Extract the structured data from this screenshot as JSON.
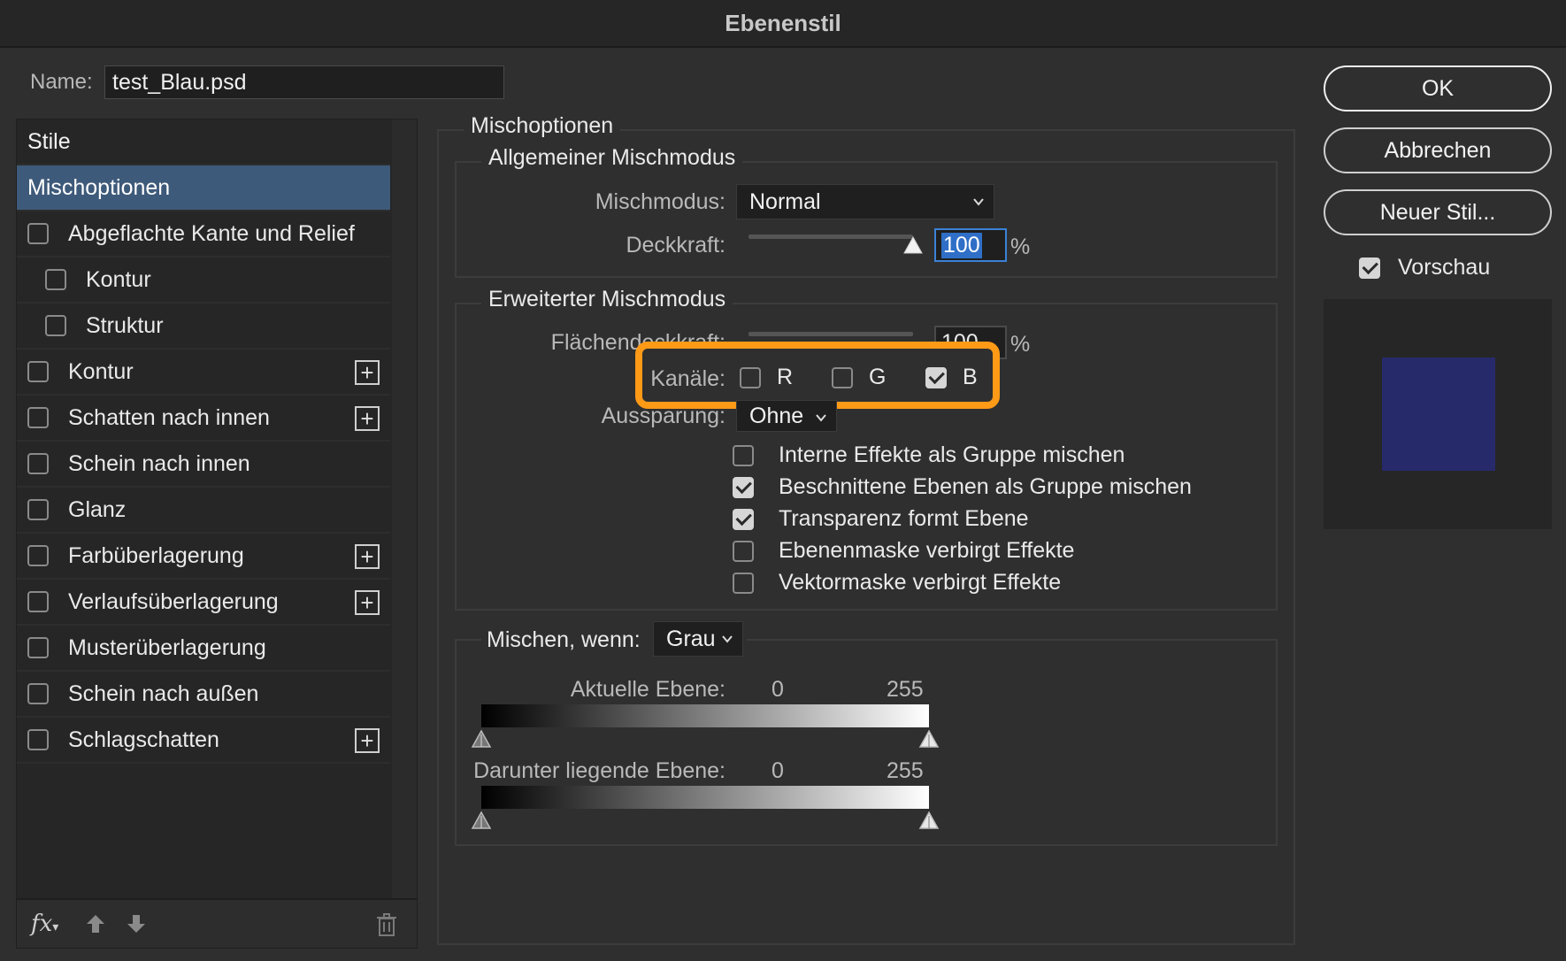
{
  "window": {
    "title": "Ebenenstil"
  },
  "name_field": {
    "label": "Name:",
    "value": "test_Blau.psd"
  },
  "style_list": {
    "header": "Stile",
    "selected": "Mischoptionen",
    "items": [
      {
        "label": "Abgeflachte Kante und Relief",
        "checked": false,
        "sub": false,
        "plus": false
      },
      {
        "label": "Kontur",
        "checked": false,
        "sub": true,
        "plus": false
      },
      {
        "label": "Struktur",
        "checked": false,
        "sub": true,
        "plus": false
      },
      {
        "label": "Kontur",
        "checked": false,
        "sub": false,
        "plus": true
      },
      {
        "label": "Schatten nach innen",
        "checked": false,
        "sub": false,
        "plus": true
      },
      {
        "label": "Schein nach innen",
        "checked": false,
        "sub": false,
        "plus": false
      },
      {
        "label": "Glanz",
        "checked": false,
        "sub": false,
        "plus": false
      },
      {
        "label": "Farbüberlagerung",
        "checked": false,
        "sub": false,
        "plus": true
      },
      {
        "label": "Verlaufsüberlagerung",
        "checked": false,
        "sub": false,
        "plus": true
      },
      {
        "label": "Musterüberlagerung",
        "checked": false,
        "sub": false,
        "plus": false
      },
      {
        "label": "Schein nach außen",
        "checked": false,
        "sub": false,
        "plus": false
      },
      {
        "label": "Schlagschatten",
        "checked": false,
        "sub": false,
        "plus": true
      }
    ],
    "footer": {
      "fx_label": "fx"
    }
  },
  "blend_options": {
    "title": "Mischoptionen",
    "general": {
      "title": "Allgemeiner Mischmodus",
      "mode_label": "Mischmodus:",
      "mode_value": "Normal",
      "opacity_label": "Deckkraft:",
      "opacity_value": "100",
      "opacity_unit": "%"
    },
    "advanced": {
      "title": "Erweiterter Mischmodus",
      "fill_label": "Flächendeckkraft:",
      "fill_value": "100",
      "fill_unit": "%",
      "channels_label": "Kanäle:",
      "channels": [
        {
          "label": "R",
          "checked": false
        },
        {
          "label": "G",
          "checked": false
        },
        {
          "label": "B",
          "checked": true
        }
      ],
      "knockout_label": "Aussparung:",
      "knockout_value": "Ohne",
      "options": [
        {
          "label": "Interne Effekte als Gruppe mischen",
          "checked": false
        },
        {
          "label": "Beschnittene Ebenen als Gruppe mischen",
          "checked": true
        },
        {
          "label": "Transparenz formt Ebene",
          "checked": true
        },
        {
          "label": "Ebenenmaske verbirgt Effekte",
          "checked": false
        },
        {
          "label": "Vektormaske verbirgt Effekte",
          "checked": false
        }
      ]
    },
    "blend_if": {
      "label": "Mischen, wenn:",
      "value": "Grau",
      "current_label": "Aktuelle Ebene:",
      "current_min": "0",
      "current_max": "255",
      "underlying_label": "Darunter liegende Ebene:",
      "underlying_min": "0",
      "underlying_max": "255"
    }
  },
  "buttons": {
    "ok": "OK",
    "cancel": "Abbrechen",
    "new_style": "Neuer Stil..."
  },
  "preview": {
    "label": "Vorschau",
    "checked": true,
    "swatch_color": "#272a6a"
  },
  "colors": {
    "highlight": "#ff9a17",
    "selection": "#3e5a7a"
  }
}
